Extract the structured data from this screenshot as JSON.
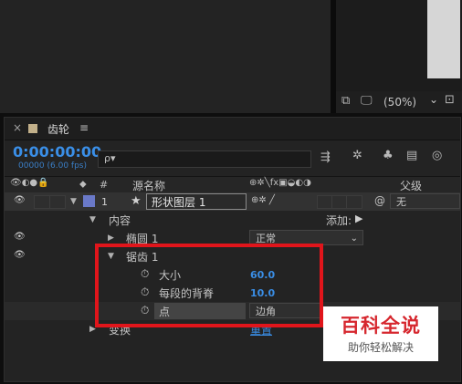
{
  "viewer": {
    "zoom_label": "(50%)",
    "zoom_arrow": "⌄"
  },
  "tab": {
    "close": "×",
    "title": "齿轮",
    "menu": "≡"
  },
  "timecode": {
    "main": "0:00:00:00",
    "sub": "00000 (6.00 fps)"
  },
  "search": {
    "placeholder": "ρ▾"
  },
  "columns": {
    "num": "#",
    "source_name": "源名称",
    "parent": "父级"
  },
  "layer": {
    "index": "1",
    "star": "★",
    "name": "形状图层 1",
    "parent_value": "无"
  },
  "props": {
    "contents": "内容",
    "add": "添加:",
    "ellipse": "椭圆 1",
    "ellipse_mode": "正常",
    "zigzag": "锯齿 1",
    "size_label": "大小",
    "size_value": "60.0",
    "ridges_label": "每段的背脊",
    "ridges_value": "10.0",
    "points_label": "点",
    "points_value": "边角",
    "transform": "变换",
    "reset": "重置"
  },
  "watermark": {
    "title": "百科全说",
    "subtitle": "助你轻松解决"
  },
  "colors": {
    "accent_blue": "#3a8ee6",
    "highlight_red": "#e0151b",
    "label_swatch": "#c2b08a",
    "layer_color": "#6a79c8"
  }
}
